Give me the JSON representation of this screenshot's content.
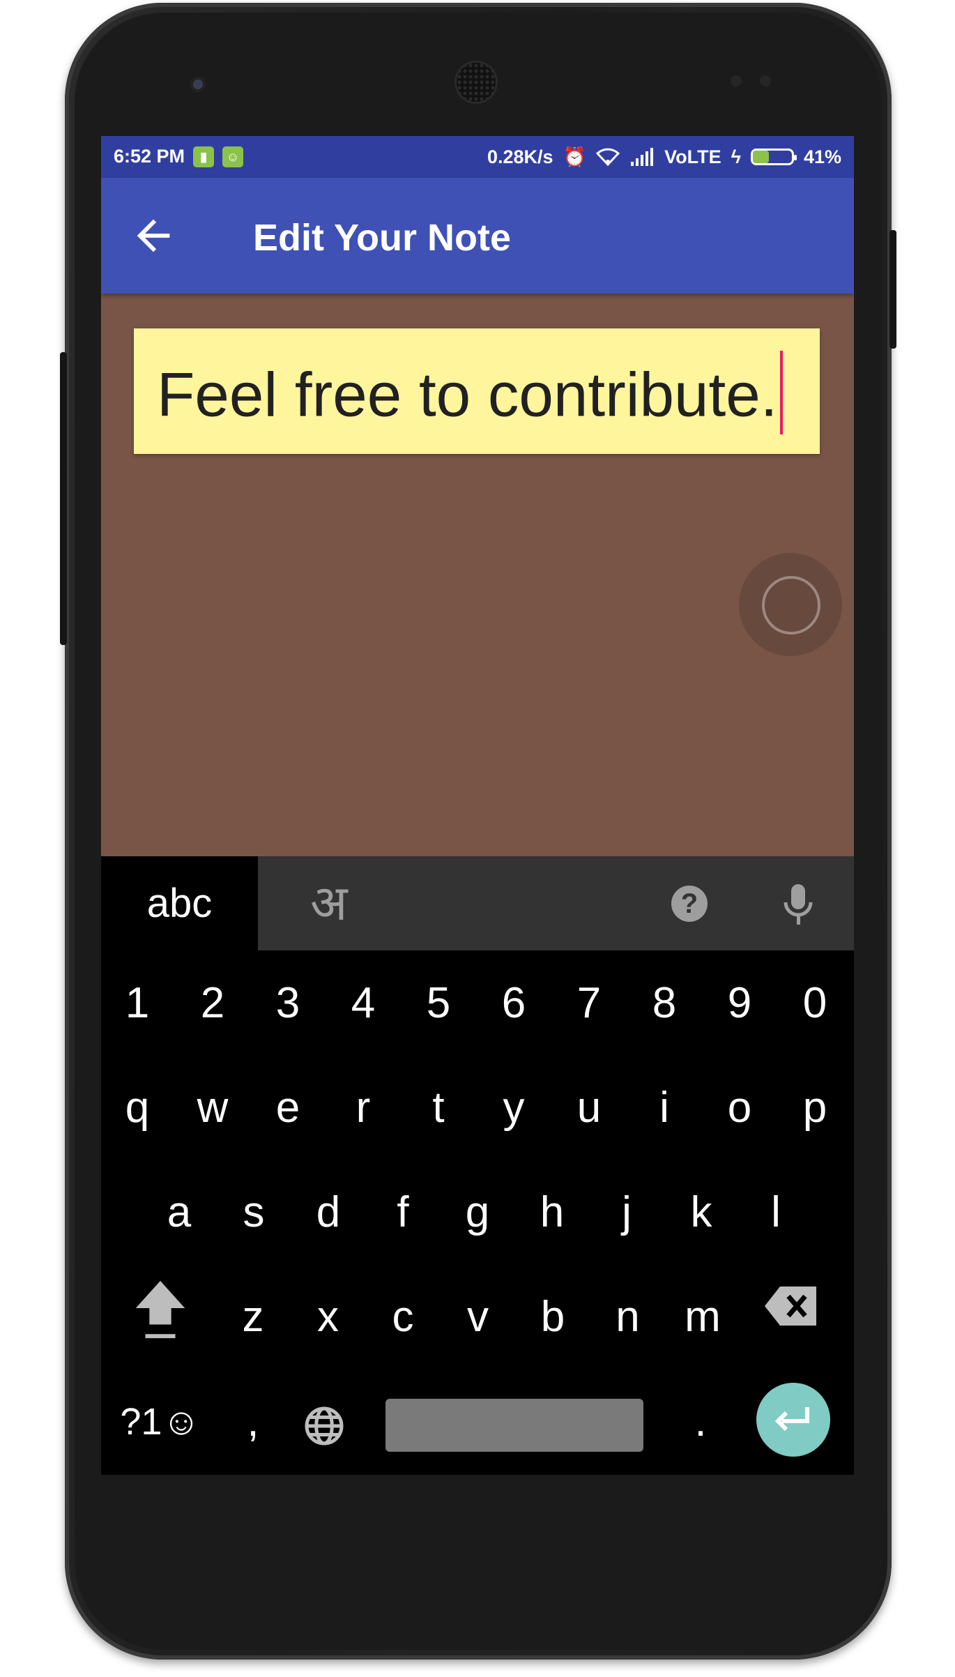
{
  "status_bar": {
    "time": "6:52 PM",
    "net_speed": "0.28K/s",
    "carrier": "VoLTE",
    "battery": "41%",
    "battery_level": 0.41,
    "icons": [
      "notification-icon",
      "android-icon",
      "alarm-icon",
      "wifi-icon",
      "signal-icon",
      "charging-icon",
      "battery-icon"
    ]
  },
  "appbar": {
    "title": "Edit Your Note",
    "back_icon": "arrow-back-icon"
  },
  "note": {
    "text": "Feel free to contribute."
  },
  "colors": {
    "status_bar": "#303f9f",
    "app_bar": "#3f51b5",
    "background": "#795548",
    "note": "#fff59d",
    "cursor": "#e91e63",
    "enter_key": "#80cbc4"
  },
  "keyboard": {
    "lang_tabs": [
      "abc",
      "अ"
    ],
    "help_label": "?",
    "number_row": [
      "1",
      "2",
      "3",
      "4",
      "5",
      "6",
      "7",
      "8",
      "9",
      "0"
    ],
    "row1": [
      "q",
      "w",
      "e",
      "r",
      "t",
      "y",
      "u",
      "i",
      "o",
      "p"
    ],
    "row2": [
      "a",
      "s",
      "d",
      "f",
      "g",
      "h",
      "j",
      "k",
      "l"
    ],
    "row3": [
      "z",
      "x",
      "c",
      "v",
      "b",
      "n",
      "m"
    ],
    "bottom": {
      "symbols": "?1☺",
      "comma": ",",
      "period": "."
    }
  }
}
